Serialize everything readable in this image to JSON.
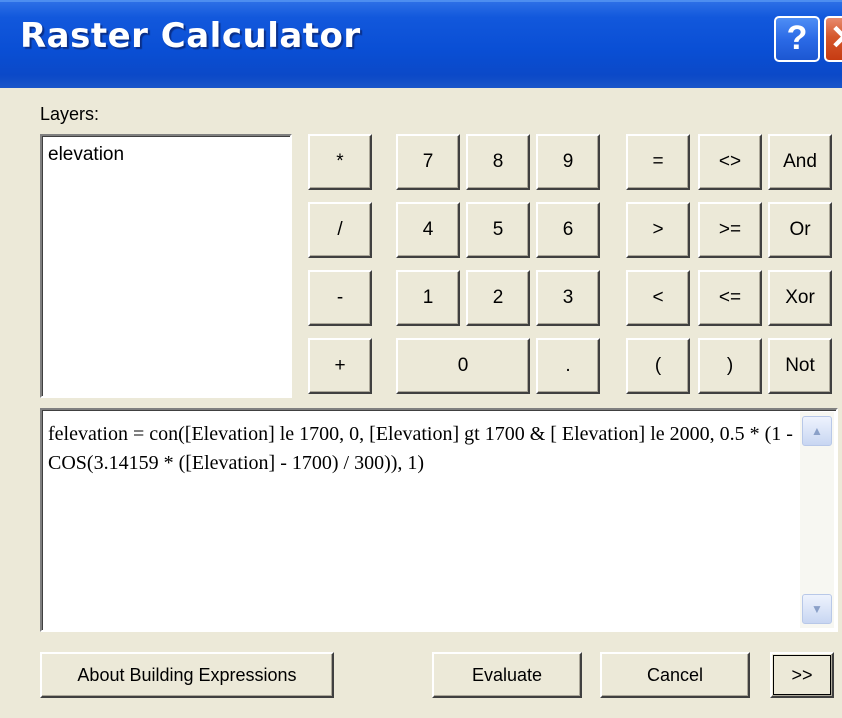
{
  "window": {
    "title": "Raster Calculator",
    "help_label": "?",
    "close_label": "✕"
  },
  "layers": {
    "label": "Layers:",
    "items": [
      "elevation"
    ]
  },
  "keypad": {
    "multiply": "*",
    "divide": "/",
    "minus": "-",
    "plus": "+",
    "seven": "7",
    "eight": "8",
    "nine": "9",
    "four": "4",
    "five": "5",
    "six": "6",
    "one": "1",
    "two": "2",
    "three": "3",
    "zero": "0",
    "dot": ".",
    "equal": "=",
    "not_equal": "<>",
    "and": "And",
    "greater": ">",
    "greater_equal": ">=",
    "or": "Or",
    "less": "<",
    "less_equal": "<=",
    "xor": "Xor",
    "open_paren": "(",
    "close_paren": ")",
    "not": "Not"
  },
  "expression": {
    "value": "felevation = con([Elevation] le 1700, 0, [Elevation] gt 1700 & [ Elevation] le 2000, 0.5 * (1 - COS(3.14159 * ([Elevation] - 1700) / 300)), 1)",
    "scroll_up_icon": "▲",
    "scroll_down_icon": "▼"
  },
  "footer": {
    "about_label": "About Building Expressions",
    "evaluate_label": "Evaluate",
    "cancel_label": "Cancel",
    "more_label": ">>"
  }
}
